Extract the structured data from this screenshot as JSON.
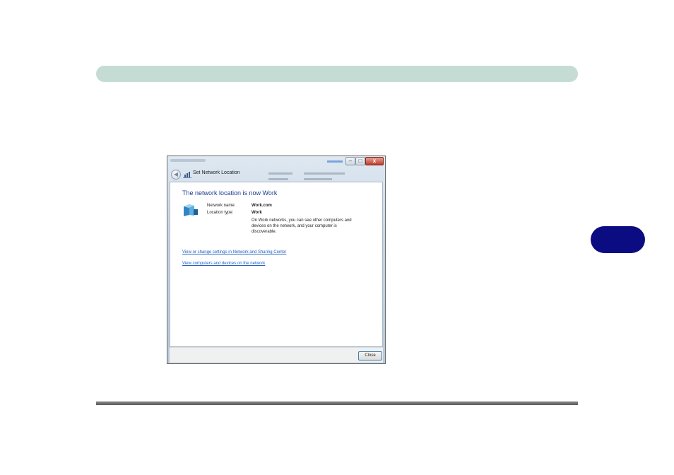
{
  "dialog": {
    "nav_title": "Set Network Location",
    "heading": "The network location is now Work",
    "network_name_label": "Network name:",
    "network_name_value": "Work.com",
    "location_type_label": "Location type:",
    "location_type_value": "Work",
    "description": "On Work networks, you can see other computers and devices on the network, and your computer is discoverable.",
    "link_settings": "View or change settings in Network and Sharing Center",
    "link_computers": "View computers and devices on the network",
    "close_button": "Close",
    "window_minimize_glyph": "–",
    "window_maximize_glyph": "□",
    "window_close_glyph": "x"
  },
  "colors": {
    "header_bar": "#c5dcd5",
    "chapter_tab": "#0c0c82",
    "heading_text": "#1e3c8c",
    "link_text": "#1f5fbf"
  },
  "icons": {
    "back": "back-arrow-icon",
    "network": "network-icon",
    "network_large": "work-network-icon"
  }
}
